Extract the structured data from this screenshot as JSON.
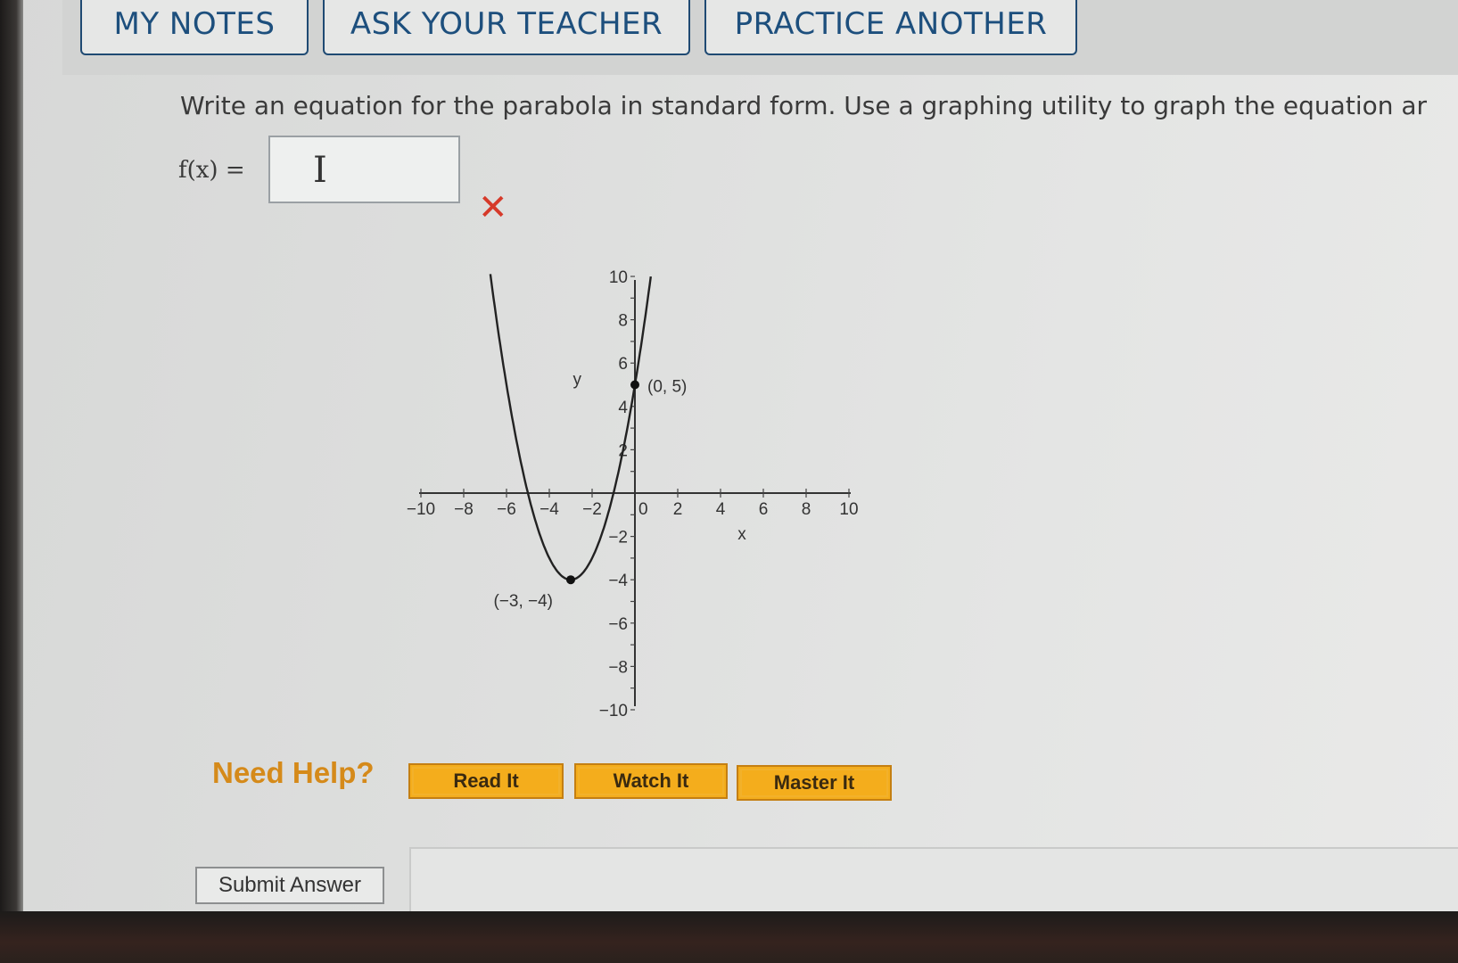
{
  "tabs": {
    "my_notes": "MY NOTES",
    "ask_teacher": "ASK YOUR TEACHER",
    "practice_another": "PRACTICE ANOTHER"
  },
  "question": {
    "text": "Write an equation for the parabola in standard form. Use a graphing utility to graph the equation ar",
    "function_label": "f(x) =",
    "answer_value": "",
    "status_icon": "✕",
    "cursor_glyph": "I"
  },
  "graph": {
    "x_axis_label": "x",
    "y_axis_label": "y",
    "x_ticks": [
      "−10",
      "−8",
      "−6",
      "−4",
      "−2",
      "0",
      "2",
      "4",
      "6",
      "8",
      "10"
    ],
    "y_ticks": [
      "10",
      "8",
      "6",
      "4",
      "2",
      "−2",
      "−4",
      "−6",
      "−8",
      "−10"
    ],
    "point_labels": [
      "(0, 5)",
      "(−3, −4)"
    ]
  },
  "help": {
    "label": "Need Help?",
    "read": "Read It",
    "watch": "Watch It",
    "master": "Master It"
  },
  "submit": "Submit Answer",
  "colors": {
    "tab_text": "#1d4f7d",
    "help_label": "#d58a1a",
    "help_button": "#f4ad1c",
    "wrong_mark": "#d63a2a"
  },
  "chart_data": {
    "type": "line",
    "series": [
      {
        "function": "(x+3)^2 - 4",
        "x_range": [
          -9,
          1.2
        ]
      }
    ],
    "points": [
      {
        "label": "(0, 5)",
        "x": 0,
        "y": 5
      },
      {
        "label": "(−3, −4)",
        "x": -3,
        "y": -4
      }
    ],
    "xlabel": "x",
    "ylabel": "y",
    "xlim": [
      -10,
      10
    ],
    "ylim": [
      -10,
      10
    ],
    "grid": false
  }
}
